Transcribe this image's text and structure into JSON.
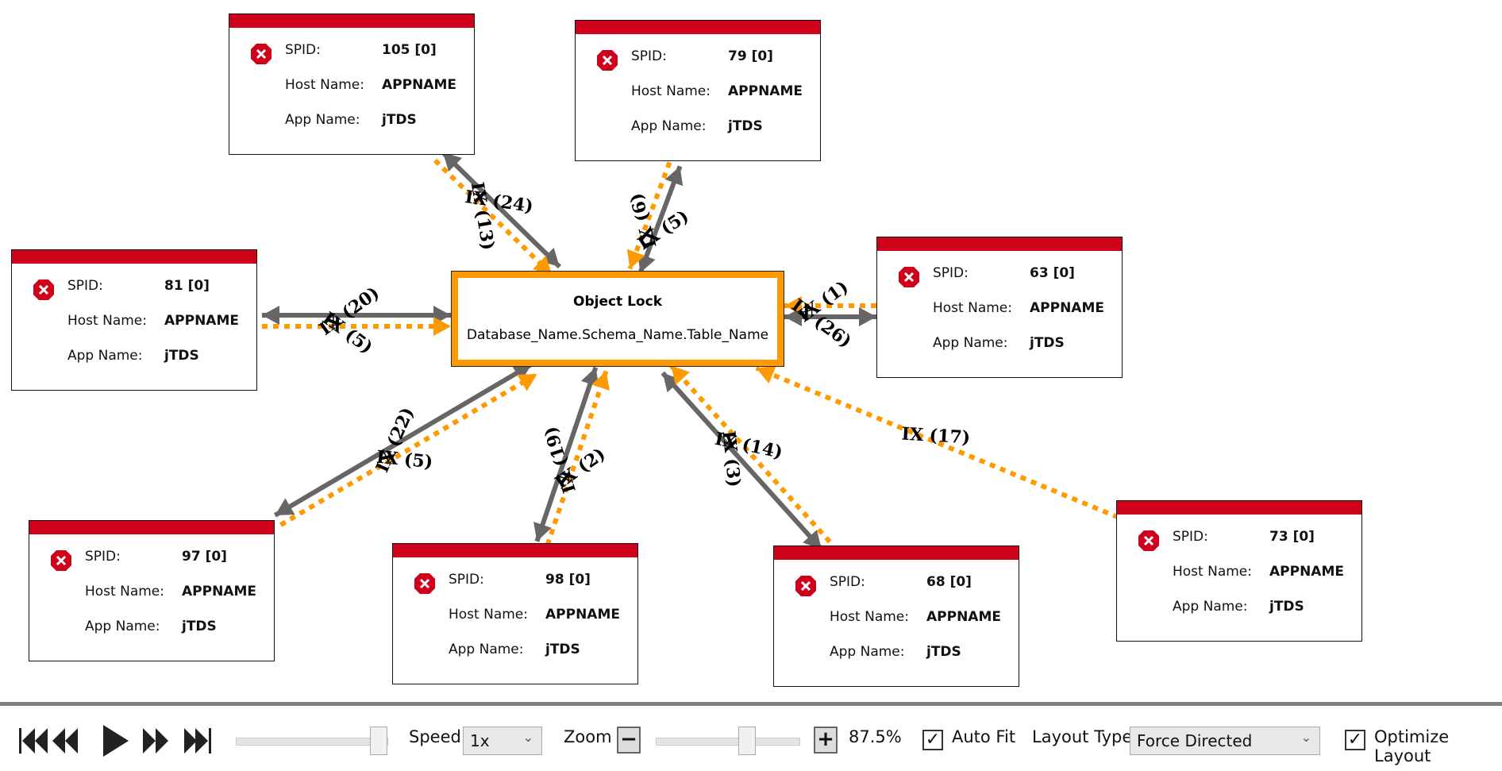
{
  "central": {
    "title": "Object Lock",
    "subtitle": "Database_Name.Schema_Name.Table_Name"
  },
  "labels": {
    "spid": "SPID:",
    "host": "Host Name:",
    "app": "App Name:"
  },
  "nodes": [
    {
      "spid": "105 [0]",
      "host": "APPNAME",
      "app": "jTDS"
    },
    {
      "spid": "79 [0]",
      "host": "APPNAME",
      "app": "jTDS"
    },
    {
      "spid": "81 [0]",
      "host": "APPNAME",
      "app": "jTDS"
    },
    {
      "spid": "63 [0]",
      "host": "APPNAME",
      "app": "jTDS"
    },
    {
      "spid": "97 [0]",
      "host": "APPNAME",
      "app": "jTDS"
    },
    {
      "spid": "98 [0]",
      "host": "APPNAME",
      "app": "jTDS"
    },
    {
      "spid": "68 [0]",
      "host": "APPNAME",
      "app": "jTDS"
    },
    {
      "spid": "73 [0]",
      "host": "APPNAME",
      "app": "jTDS"
    }
  ],
  "edges": [
    {
      "node": 0,
      "labels": [
        "IX (24)",
        "IX (13)"
      ]
    },
    {
      "node": 1,
      "labels": [
        "IX (6)",
        "IX (5)"
      ]
    },
    {
      "node": 2,
      "labels": [
        "IX (20)",
        "IX (5)"
      ]
    },
    {
      "node": 3,
      "labels": [
        "IX (1)",
        "IX (26)"
      ]
    },
    {
      "node": 4,
      "labels": [
        "IX (22)",
        "IX (5)"
      ]
    },
    {
      "node": 5,
      "labels": [
        "IX (19)",
        "IX (2)"
      ]
    },
    {
      "node": 6,
      "labels": [
        "IX (14)",
        "IX (3)"
      ]
    },
    {
      "node": 7,
      "labels": [
        "IX (17)"
      ]
    }
  ],
  "colors": {
    "header": "#d0021b",
    "lock": "#ff9900",
    "edge": "#666666"
  },
  "toolbar": {
    "speed_label": "Speed",
    "speed_value": "1x",
    "zoom_label": "Zoom",
    "zoom_value": "87.5%",
    "auto_fit_label": "Auto Fit",
    "auto_fit": true,
    "layout_label": "Layout Type",
    "layout_value": "Force Directed",
    "optimize_label": "Optimize Layout",
    "optimize": true,
    "playback_position": 1.0,
    "zoom_slider": 0.62
  }
}
